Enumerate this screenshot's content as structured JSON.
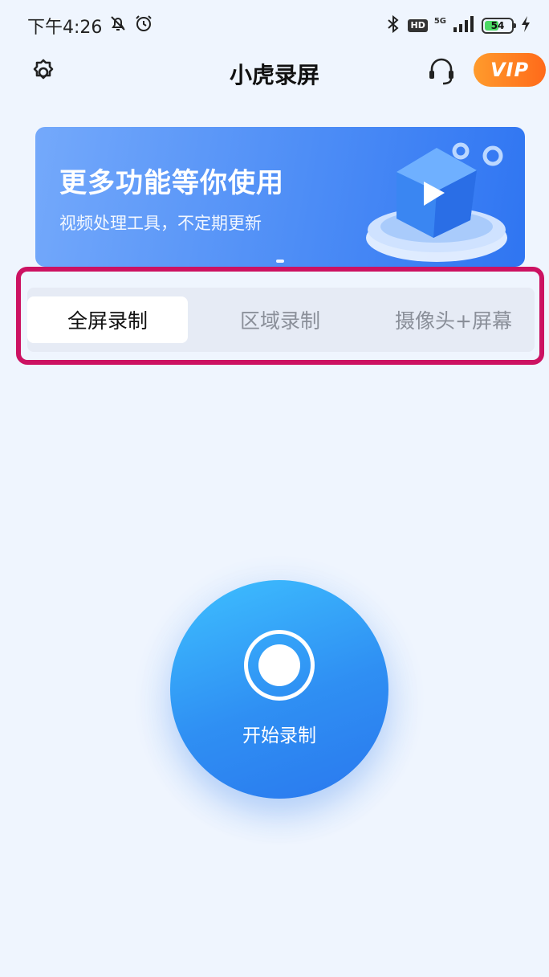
{
  "status_bar": {
    "time": "下午4:26",
    "network": "5G",
    "hd_badge": "HD",
    "battery_level": "54",
    "battery_percent": 54,
    "icons": [
      "mute-bell-icon",
      "alarm-icon",
      "bluetooth-icon",
      "signal-icon",
      "charging-icon"
    ]
  },
  "header": {
    "title": "小虎录屏",
    "vip_label": "VIP",
    "icons": [
      "settings-gear-icon",
      "headset-support-icon"
    ]
  },
  "banner": {
    "title": "更多功能等你使用",
    "subtitle": "视频处理工具，不定期更新",
    "art_icon": "play-cube-icon"
  },
  "mode_tabs": {
    "items": [
      {
        "label": "全屏录制",
        "active": true
      },
      {
        "label": "区域录制",
        "active": false
      },
      {
        "label": "摄像头+屏幕",
        "active": false
      }
    ]
  },
  "record": {
    "label": "开始录制",
    "icon": "record-icon"
  },
  "colors": {
    "page_bg": "#eff5fe",
    "accent_blue": "#2f8ff3",
    "vip_orange": "#ff7a1f",
    "highlight_magenta": "#cc1262"
  }
}
